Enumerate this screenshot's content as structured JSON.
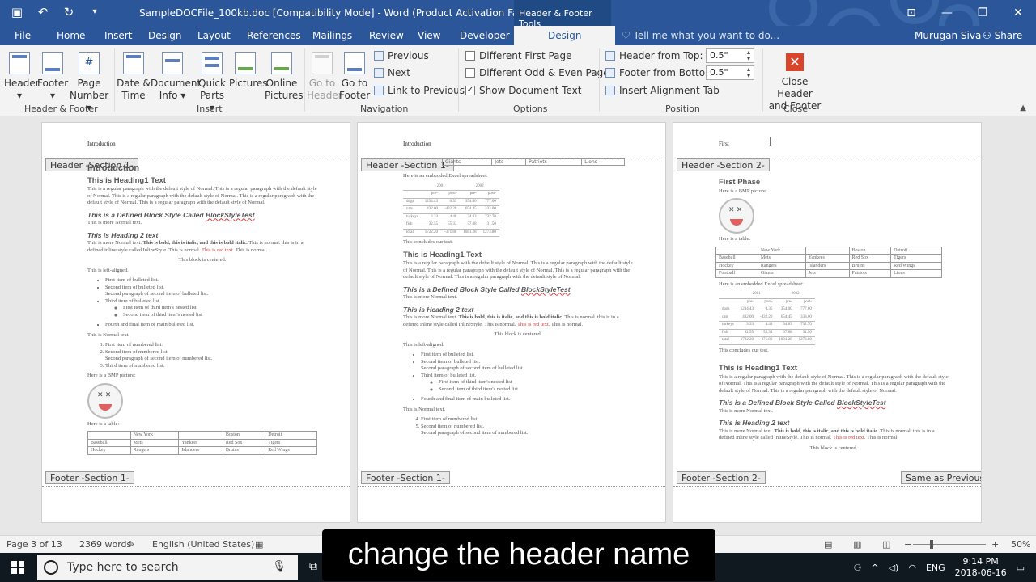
{
  "titlebar": {
    "title": "SampleDOCFile_100kb.doc [Compatibility Mode] - Word (Product Activation Failed)",
    "contextual": "Header & Footer Tools",
    "qat": {
      "save": "save-icon",
      "undo": "undo-icon",
      "redo": "redo-icon",
      "more": "more-icon"
    }
  },
  "tabs": [
    "File",
    "Home",
    "Insert",
    "Design",
    "Layout",
    "References",
    "Mailings",
    "Review",
    "View",
    "Developer",
    "Design"
  ],
  "tell_me": "Tell me what you want to do...",
  "user": "Murugan Siva",
  "share": "Share",
  "ribbon": {
    "hf": {
      "header": "Header",
      "footer": "Footer",
      "page_number_1": "Page",
      "page_number_2": "Number",
      "label": "Header & Footer"
    },
    "insert": {
      "date_1": "Date &",
      "date_2": "Time",
      "docinfo_1": "Document",
      "docinfo_2": "Info",
      "quick_1": "Quick",
      "quick_2": "Parts",
      "pictures": "Pictures",
      "online_1": "Online",
      "online_2": "Pictures",
      "label": "Insert"
    },
    "nav": {
      "goto_header_1": "Go to",
      "goto_header_2": "Header",
      "goto_footer_1": "Go to",
      "goto_footer_2": "Footer",
      "previous": "Previous",
      "next": "Next",
      "link": "Link to Previous",
      "label": "Navigation"
    },
    "options": {
      "diff_first": "Different First Page",
      "diff_odd": "Different Odd & Even Pages",
      "show_text": "Show Document Text",
      "show_text_checked": "✓",
      "label": "Options"
    },
    "position": {
      "header_top": "Header from Top:",
      "header_top_val": "0.5\"",
      "footer_bottom": "Footer from Bottom:",
      "footer_bottom_val": "0.5\"",
      "align_tab": "Insert Alignment Tab",
      "label": "Position"
    },
    "close": {
      "label_1": "Close Header",
      "label_2": "and Footer",
      "group": "Close"
    }
  },
  "pages": [
    {
      "header_text": "Introduction",
      "header_tag": "Header -Section 1-",
      "footer_tag": "Footer -Section 1-"
    },
    {
      "header_text": "Introduction",
      "header_tag": "Header -Section 1-",
      "footer_tag": "Footer -Section 1-"
    },
    {
      "header_text": "First",
      "header_tag": "Header -Section 2-",
      "footer_tag": "Footer -Section 2-",
      "same_as_prev": "Same as Previous"
    }
  ],
  "doc": {
    "introduction": "Introduction",
    "h1": "This is Heading1 Text",
    "normal_para": "This is a regular paragraph with the default style of Normal. This is a regular paragraph with the default style of Normal. This is a regular paragraph with the default style of Normal. This is a regular paragraph with the default style of Normal. This is a regular paragraph with the default style of Normal.",
    "block_style_1": "This is a Defined Block Style Called ",
    "block_style_2": "BlockStyleTest",
    "more_normal": "This is more Normal text.",
    "h2": "This is Heading 2 text",
    "inline_1": "This is more Normal text. ",
    "inline_2": "This is bold, this is italic, and this is bold italic.",
    "inline_3": " This is normal. this is in a defined inline style called InlineStyle. This is normal. ",
    "inline_4": "This is red text.",
    "inline_5": " This is normal.",
    "centered": "This block is centered.",
    "left_aligned": "This is left-aligned.",
    "bullets": [
      "First item of bulleted list.",
      "Second item of bulleted list.",
      "Second paragraph of second item of bulleted list.",
      "Third item of bulleted list.",
      "Fourth and final item of main bulleted list."
    ],
    "nested": [
      "First item of third item's nested list",
      "Second item of third item's nested list"
    ],
    "normal_text": "This is Normal text.",
    "numbered": [
      "First item of numbered list.",
      "Second item of numbered list.",
      "Second paragraph of second item of numbered list.",
      "Third item of numbered list."
    ],
    "bmp": "Here is a BMP picture:",
    "table_intro": "Here is a table:",
    "table_header": [
      "",
      "New York",
      "",
      "Boston",
      "Detroit"
    ],
    "table_rows": [
      [
        "Baseball",
        "Mets",
        "Yankees",
        "Red Sox",
        "Tigers"
      ],
      [
        "Hockey",
        "Rangers",
        "Islanders",
        "Bruins",
        "Red Wings"
      ],
      [
        "Football",
        "Giants",
        "Jets",
        "Patriots",
        "Lions"
      ]
    ],
    "excel_intro": "Here is an embedded Excel spreadsheet:",
    "excel_years": [
      "2001",
      "2002"
    ],
    "excel_cols": [
      "",
      "pre-",
      "post-",
      "pre-",
      "post-"
    ],
    "excel_rows": [
      [
        "dogs",
        "1234.43",
        "0.35",
        "354.00",
        "777.00"
      ],
      [
        "cats",
        "432.00",
        "-432.20",
        "654.45",
        "333.00"
      ],
      [
        "turkeys",
        "3.33",
        "4.48",
        "34.83",
        "732.70"
      ],
      [
        "fish",
        "32.55",
        "55.33",
        "37.88",
        "31.50"
      ],
      [
        "total",
        "1722.20",
        "-371.88",
        "1081.28",
        "1273.80"
      ]
    ],
    "concludes": "This concludes our test.",
    "first_phase": "First Phase"
  },
  "status": {
    "page": "Page 3 of 13",
    "words": "2369 words",
    "language": "English (United States)",
    "zoom": "50%"
  },
  "taskbar": {
    "search": "Type here to search",
    "time": "9:14 PM",
    "date": "2018-06-16",
    "lang": "ENG"
  },
  "caption": "change the header name"
}
